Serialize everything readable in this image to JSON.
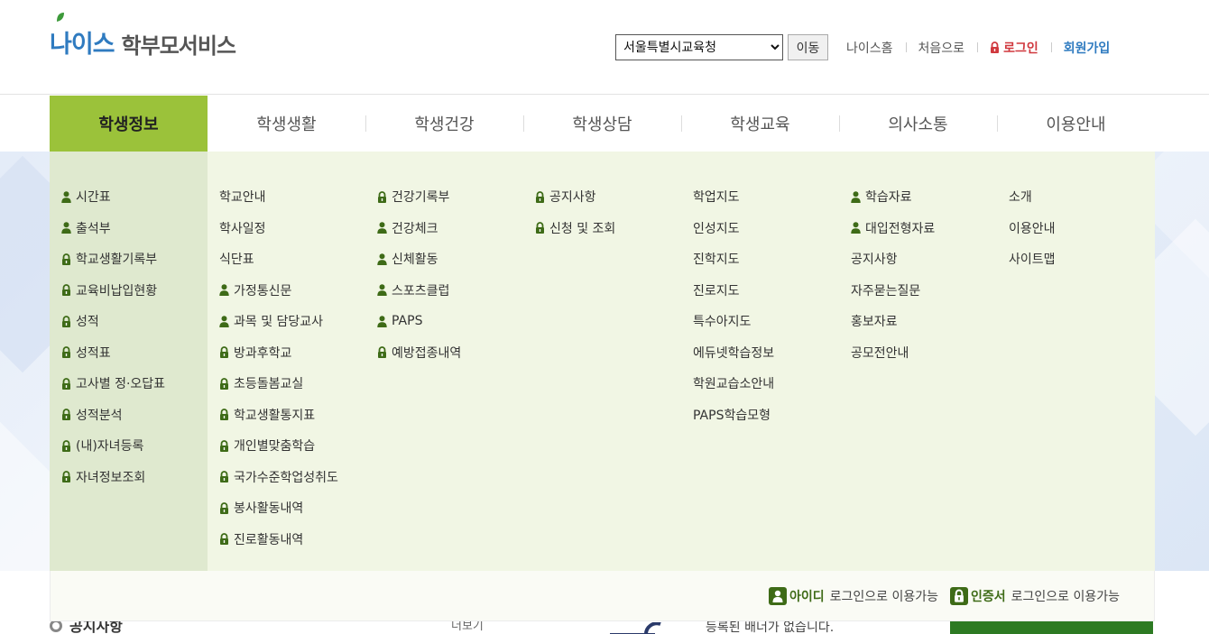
{
  "header": {
    "logo": {
      "brand": "나이스",
      "service": "학부모서비스"
    },
    "region_select": {
      "selected": "서울특별시교육청"
    },
    "go_button": "이동",
    "links": [
      {
        "label": "나이스홈"
      },
      {
        "label": "처음으로"
      },
      {
        "label": "로그인",
        "icon": "lock-icon"
      },
      {
        "label": "회원가입"
      }
    ]
  },
  "gnb": {
    "active_index": 0,
    "items": [
      "학생정보",
      "학생생활",
      "학생건강",
      "학생상담",
      "학생교육",
      "의사소통",
      "이용안내"
    ]
  },
  "mega_menu": {
    "columns": [
      [
        {
          "label": "시간표",
          "icon": "user"
        },
        {
          "label": "출석부",
          "icon": "user"
        },
        {
          "label": "학교생활기록부",
          "icon": "lock"
        },
        {
          "label": "교육비납입현황",
          "icon": "lock"
        },
        {
          "label": "성적",
          "icon": "lock"
        },
        {
          "label": "성적표",
          "icon": "lock"
        },
        {
          "label": "고사별 정·오답표",
          "icon": "lock"
        },
        {
          "label": "성적분석",
          "icon": "lock"
        },
        {
          "label": "(내)자녀등록",
          "icon": "lock"
        },
        {
          "label": "자녀정보조회",
          "icon": "lock"
        }
      ],
      [
        {
          "label": "학교안내",
          "icon": ""
        },
        {
          "label": "학사일정",
          "icon": ""
        },
        {
          "label": "식단표",
          "icon": ""
        },
        {
          "label": "가정통신문",
          "icon": "user"
        },
        {
          "label": "과목 및 담당교사",
          "icon": "user"
        },
        {
          "label": "방과후학교",
          "icon": "lock"
        },
        {
          "label": "초등돌봄교실",
          "icon": "lock"
        },
        {
          "label": "학교생활통지표",
          "icon": "lock"
        },
        {
          "label": "개인별맞춤학습",
          "icon": "lock"
        },
        {
          "label": "국가수준학업성취도",
          "icon": "lock"
        },
        {
          "label": "봉사활동내역",
          "icon": "lock"
        },
        {
          "label": "진로활동내역",
          "icon": "lock"
        }
      ],
      [
        {
          "label": "건강기록부",
          "icon": "lock"
        },
        {
          "label": "건강체크",
          "icon": "user"
        },
        {
          "label": "신체활동",
          "icon": "user"
        },
        {
          "label": "스포츠클럽",
          "icon": "user"
        },
        {
          "label": "PAPS",
          "icon": "user"
        },
        {
          "label": "예방접종내역",
          "icon": "lock"
        }
      ],
      [
        {
          "label": "공지사항",
          "icon": "lock"
        },
        {
          "label": "신청 및 조회",
          "icon": "lock"
        }
      ],
      [
        {
          "label": "학업지도",
          "icon": ""
        },
        {
          "label": "인성지도",
          "icon": ""
        },
        {
          "label": "진학지도",
          "icon": ""
        },
        {
          "label": "진로지도",
          "icon": ""
        },
        {
          "label": "특수아지도",
          "icon": ""
        },
        {
          "label": "에듀넷학습정보",
          "icon": ""
        },
        {
          "label": "학원교습소안내",
          "icon": ""
        },
        {
          "label": "PAPS학습모형",
          "icon": ""
        }
      ],
      [
        {
          "label": "학습자료",
          "icon": "user"
        },
        {
          "label": "대입전형자료",
          "icon": "user"
        },
        {
          "label": "공지사항",
          "icon": ""
        },
        {
          "label": "자주묻는질문",
          "icon": ""
        },
        {
          "label": "홍보자료",
          "icon": ""
        },
        {
          "label": "공모전안내",
          "icon": ""
        }
      ],
      [
        {
          "label": "소개",
          "icon": ""
        },
        {
          "label": "이용안내",
          "icon": ""
        },
        {
          "label": "사이트맵",
          "icon": ""
        }
      ]
    ]
  },
  "legend": [
    {
      "strong": "아이디",
      "text": "로그인으로 이용가능",
      "icon": "user-icon"
    },
    {
      "strong": "인증서",
      "text": "로그인으로 이용가능",
      "icon": "lock-icon"
    }
  ],
  "below": {
    "notice_title": "공지사항",
    "more": "더보기",
    "banner_empty": "등록된 배너가 없습니다."
  },
  "colors": {
    "active_menu": "#9bc23a",
    "icon_green": "#3e6b17",
    "login_red": "#d0383e",
    "brand_blue": "#2f7bc0"
  }
}
